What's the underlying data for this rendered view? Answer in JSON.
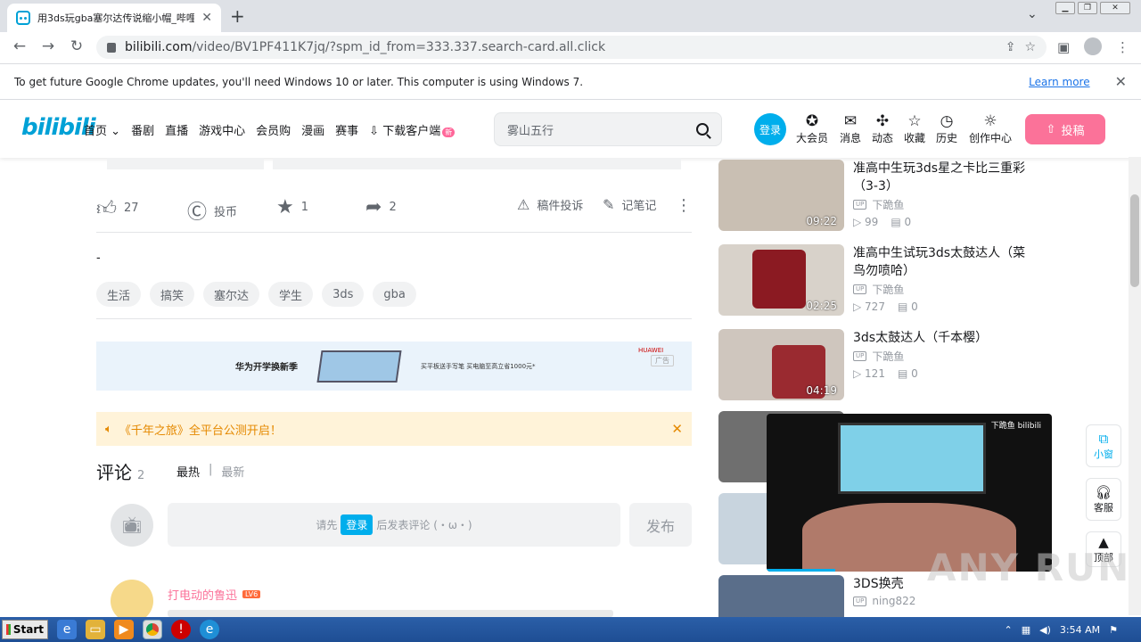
{
  "browser": {
    "tab_title": "用3ds玩gba塞尔达传说缩小帽_哔哩",
    "url_host": "bilibili.com",
    "url_path": "/video/BV1PF411K7jq/?spm_id_from=333.337.search-card.all.click",
    "infobar_message": "To get future Google Chrome updates, you'll need Windows 10 or later. This computer is using Windows 7.",
    "infobar_link": "Learn more"
  },
  "header": {
    "logo": "bilibili",
    "nav": [
      {
        "label": "首页"
      },
      {
        "label": "番剧"
      },
      {
        "label": "直播"
      },
      {
        "label": "游戏中心"
      },
      {
        "label": "会员购"
      },
      {
        "label": "漫画"
      },
      {
        "label": "赛事"
      },
      {
        "label": "下载客户端"
      }
    ],
    "download_badge": "新",
    "search_placeholder": "雾山五行",
    "login": "登录",
    "items": [
      {
        "label": "大会员",
        "icon": "vip-icon"
      },
      {
        "label": "消息",
        "icon": "message-icon"
      },
      {
        "label": "动态",
        "icon": "dynamic-icon"
      },
      {
        "label": "收藏",
        "icon": "favorite-icon"
      },
      {
        "label": "历史",
        "icon": "history-icon"
      },
      {
        "label": "创作中心",
        "icon": "creator-icon"
      }
    ],
    "upload": "投稿"
  },
  "video": {
    "like_count": "27",
    "coin_label": "投币",
    "favorite_count": "1",
    "share_count": "2",
    "report": "稿件投诉",
    "notes": "记笔记",
    "description": "-",
    "tags": [
      "生活",
      "搞笑",
      "塞尔达",
      "学生",
      "3ds",
      "gba"
    ]
  },
  "ad": {
    "headline": "华为开学换新季",
    "subline": "买平板送手写笔   买电脑至高立省1000元*",
    "brand": "HUAWEI",
    "tag": "广告"
  },
  "notice": {
    "text": "《千年之旅》全平台公测开启！"
  },
  "comments": {
    "title": "评论",
    "count": "2",
    "sort_hot": "最热",
    "sort_new": "最新",
    "prompt_before": "请先",
    "prompt_login": "登录",
    "prompt_after": "后发表评论 (・ω・)",
    "send": "发布",
    "first_user": "打电动的鲁迅",
    "first_user_level": "LV6"
  },
  "recommendations": [
    {
      "title": "准高中生玩3ds星之卡比三重彩（3-3）",
      "duration": "09:22",
      "up": "下跪鱼",
      "views": "99",
      "danmaku": "0"
    },
    {
      "title": "准高中生试玩3ds太鼓达人（菜鸟勿喷哈）",
      "duration": "02:25",
      "up": "下跪鱼",
      "views": "727",
      "danmaku": "0"
    },
    {
      "title": "3ds太鼓达人（千本樱）",
      "duration": "04:19",
      "up": "下跪鱼",
      "views": "121",
      "danmaku": "0"
    },
    {
      "title": "3DS换壳",
      "duration": "",
      "up": "ning822",
      "views": "",
      "danmaku": ""
    }
  ],
  "mini_player": {
    "brand": "下跪鱼 bilibili",
    "progress": 0.24
  },
  "side_buttons": [
    {
      "label": "小窗",
      "icon": "mini-window-icon"
    },
    {
      "label": "客服",
      "icon": "headset-icon"
    },
    {
      "label": "顶部",
      "icon": "arrow-up-icon"
    }
  ],
  "watermark": "ANY RUN",
  "taskbar": {
    "start": "Start",
    "time": "3:54 AM"
  },
  "colors": {
    "brand_blue": "#00a1d6",
    "brand_pink": "#fb7299",
    "login_blue": "#00aeec"
  }
}
